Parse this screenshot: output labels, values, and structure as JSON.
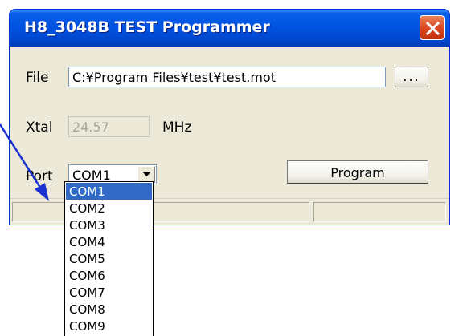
{
  "window": {
    "title": "H8_3048B TEST Programmer",
    "close_icon": "close-icon"
  },
  "form": {
    "file_label": "File",
    "file_path": "C:¥Program Files¥test¥test.mot",
    "browse_label": "...",
    "xtal_label": "Xtal",
    "xtal_value": "24.57",
    "xtal_unit": "MHz",
    "port_label": "Port",
    "port_selected": "COM1",
    "program_label": "Program"
  },
  "port_dropdown": {
    "options": [
      "COM1",
      "COM2",
      "COM3",
      "COM4",
      "COM5",
      "COM6",
      "COM7",
      "COM8",
      "COM9"
    ],
    "highlighted": "COM1"
  },
  "annotation": {
    "color": "#1a30d0"
  },
  "colors": {
    "titlebar": "#0054e3",
    "close_button": "#d8451f",
    "selection": "#316ac5",
    "dialog_background": "#ece9d8"
  }
}
